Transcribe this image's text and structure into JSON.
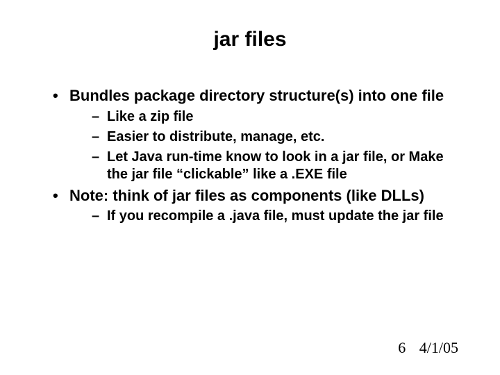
{
  "title": "jar files",
  "bullets": {
    "b1": "Bundles package directory structure(s) into one file",
    "b1_sub": {
      "s1": "Like a zip file",
      "s2": "Easier to distribute, manage, etc.",
      "s3": "Let Java run-time know to look in a jar file, or Make the jar file “clickable” like a .EXE file"
    },
    "b2": "Note: think of jar files as components (like DLLs)",
    "b2_sub": {
      "s1": "If you recompile a .java file, must update the jar file"
    }
  },
  "footer": {
    "page": "6",
    "date": "4/1/05"
  }
}
